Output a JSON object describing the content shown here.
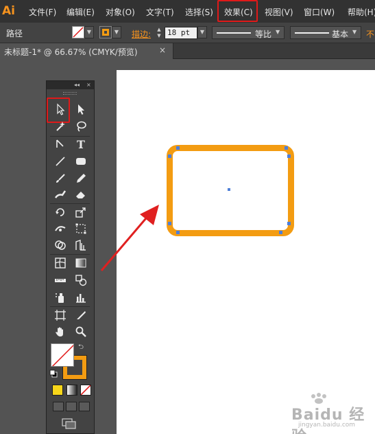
{
  "app": {
    "logo": "Ai"
  },
  "menubar": {
    "items": [
      "文件(F)",
      "编辑(E)",
      "对象(O)",
      "文字(T)",
      "选择(S)",
      "效果(C)",
      "视图(V)",
      "窗口(W)",
      "帮助(H)"
    ],
    "highlighted": "效果(C)"
  },
  "controlbar": {
    "selection_label": "路径",
    "stroke_label": "描边:",
    "stroke_weight": "18 pt",
    "profile_label": "等比",
    "brush_label": "基本",
    "opacity_label": "不"
  },
  "document": {
    "tab_title": "未标题-1* @ 66.67% (CMYK/预览)",
    "close": "×"
  },
  "toolbar": {
    "header_collapse": "◂◂",
    "header_close": "×",
    "highlighted_tool": "selection-tool"
  },
  "colors": {
    "stroke": "#f39c12",
    "highlight": "#e01919",
    "anchor": "#4f7fd8",
    "arrow": "#e02020"
  },
  "watermark": {
    "logo": "Baidu 经验",
    "url": "jingyan.baidu.com"
  }
}
